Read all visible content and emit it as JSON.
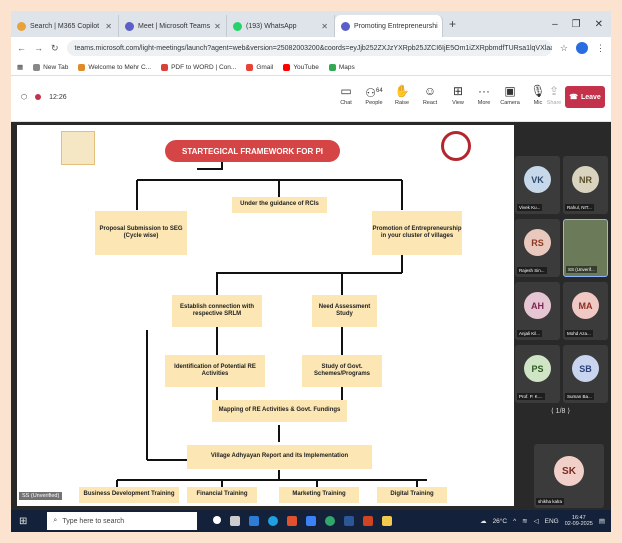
{
  "browser": {
    "tabs": [
      {
        "label": "Search | M365 Copilot",
        "color": "#e9a23b"
      },
      {
        "label": "Meet | Microsoft Teams",
        "color": "#5b5fc7"
      },
      {
        "label": "(193) WhatsApp",
        "color": "#25d366"
      },
      {
        "label": "Promoting Entrepreneurshi",
        "color": "#5b5fc7"
      }
    ],
    "url": "teams.microsoft.com/light-meetings/launch?agent=web&version=25082003200&coords=eyJjb252ZXJzYXRpb25JZCI6IjE5Om1iZXRpbmdfTURsa1lqVXlaamN0WmpSaU15MD...",
    "bookmarks": [
      "New Tab",
      "Welcome to Mehr C...",
      "PDF to WORD | Con...",
      "Gmail",
      "YouTube",
      "Maps"
    ]
  },
  "meeting": {
    "time": "12:26",
    "people_count": "64",
    "buttons": [
      "Chat",
      "People",
      "Raise",
      "React",
      "View",
      "More",
      "Camera",
      "Mic",
      "Share"
    ],
    "leave_label": "Leave",
    "pager": "⟨  1/8  ⟩",
    "self_tag": "SS (Unverified)"
  },
  "slide": {
    "title": "STARTEGICAL FRAMEWORK FOR PI",
    "guidance": "Under the guidance of RCIs",
    "proposal": "Proposal Submission to SEG (Cycle wise)",
    "promotion": "Promotion of Entrepreneurship in your cluster of villages",
    "establish": "Establish connection with respective SRLM",
    "needs": "Need Assessment Study",
    "identification": "Identification of Potential RE Activities",
    "govt": "Study of Govt. Schemes/Programs",
    "mapping": "Mapping of RE Activities & Govt. Fundings",
    "report": "Village Adhyayan Report and its Implementation",
    "trainings": [
      "Business Development Training",
      "Financial Training",
      "Marketing Training",
      "Digital Training"
    ]
  },
  "participants": [
    {
      "initials": "VK",
      "name": "Vivek Ku...",
      "bg": "#c7d8ea",
      "fg": "#2b4a6f"
    },
    {
      "initials": "NR",
      "name": "Rahul, NIT...",
      "bg": "#d9d3bf",
      "fg": "#5a4e2a"
    },
    {
      "initials": "RS",
      "name": "Rajesh Sin...",
      "bg": "#e9c9bd",
      "fg": "#8a3a22"
    },
    {
      "initials": "",
      "name": "SS (Unverif...",
      "bg": "#6b7a58",
      "fg": "#fff"
    },
    {
      "initials": "AH",
      "name": "Anjali Kil...",
      "bg": "#e7c6d4",
      "fg": "#7a2750"
    },
    {
      "initials": "MA",
      "name": "Mohd Aza...",
      "bg": "#f0c9c4",
      "fg": "#8c2e26"
    },
    {
      "initials": "PS",
      "name": "Prof. P. K....",
      "bg": "#cfe5c6",
      "fg": "#2d5a1f"
    },
    {
      "initials": "SB",
      "name": "Suman Ba...",
      "bg": "#c9d4ee",
      "fg": "#2b3f7a"
    }
  ],
  "bottom_participant": {
    "initials": "SK",
    "name": "shikha kalra",
    "bg": "#f0d0c8",
    "fg": "#7a2a22"
  },
  "taskbar": {
    "search_placeholder": "Type here to search",
    "weather": "26°C",
    "lang": "ENG",
    "clock_time": "16:47",
    "clock_date": "02-09-2025"
  }
}
